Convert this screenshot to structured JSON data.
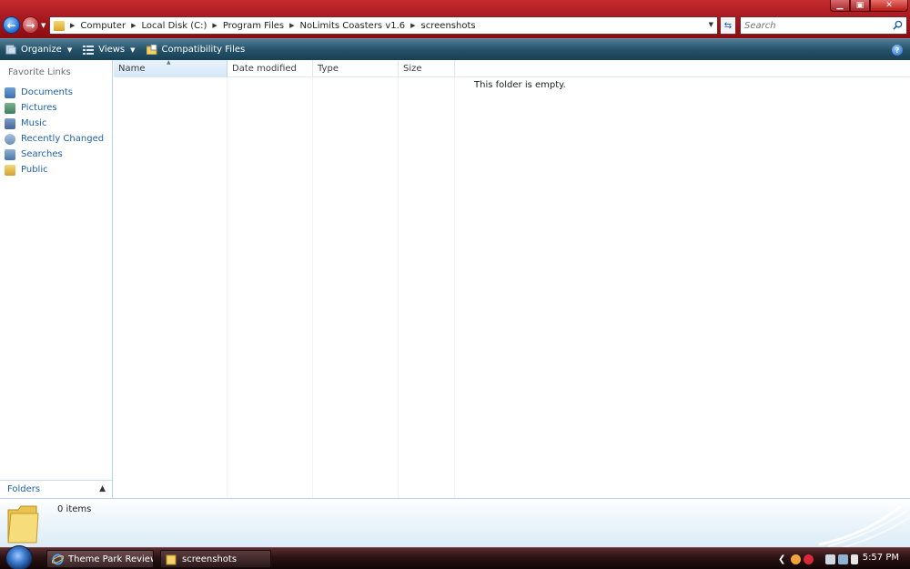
{
  "window": {
    "controls": {
      "minimize": "▁",
      "maximize": "▣",
      "close": "✕"
    }
  },
  "nav": {
    "back_icon": "back-arrow-icon",
    "forward_icon": "forward-arrow-icon"
  },
  "address": {
    "breadcrumbs": [
      "Computer",
      "Local Disk (C:)",
      "Program Files",
      "NoLimits Coasters v1.6",
      "screenshots"
    ]
  },
  "search": {
    "placeholder": "Search"
  },
  "toolbar": {
    "organize_label": "Organize",
    "views_label": "Views",
    "compat_label": "Compatibility Files",
    "help": "?"
  },
  "navpane": {
    "title": "Favorite Links",
    "items": [
      {
        "label": "Documents",
        "icon": "documents-icon"
      },
      {
        "label": "Pictures",
        "icon": "pictures-icon"
      },
      {
        "label": "Music",
        "icon": "music-icon"
      },
      {
        "label": "Recently Changed",
        "icon": "recently-changed-icon"
      },
      {
        "label": "Searches",
        "icon": "searches-icon"
      },
      {
        "label": "Public",
        "icon": "public-icon"
      }
    ],
    "folders_label": "Folders"
  },
  "filelist": {
    "columns": [
      "Name",
      "Date modified",
      "Type",
      "Size"
    ],
    "empty_message": "This folder is empty."
  },
  "details": {
    "items_count": "0 items"
  },
  "taskbar": {
    "buttons": [
      {
        "label": "Theme Park Review ...",
        "icon": "internet-explorer-icon"
      },
      {
        "label": "screenshots",
        "icon": "folder-icon"
      }
    ],
    "clock": "5:57 PM"
  },
  "colors": {
    "title_red": "#a81a20",
    "cmdbar_teal": "#26536a",
    "link_blue": "#1e5fa8"
  }
}
